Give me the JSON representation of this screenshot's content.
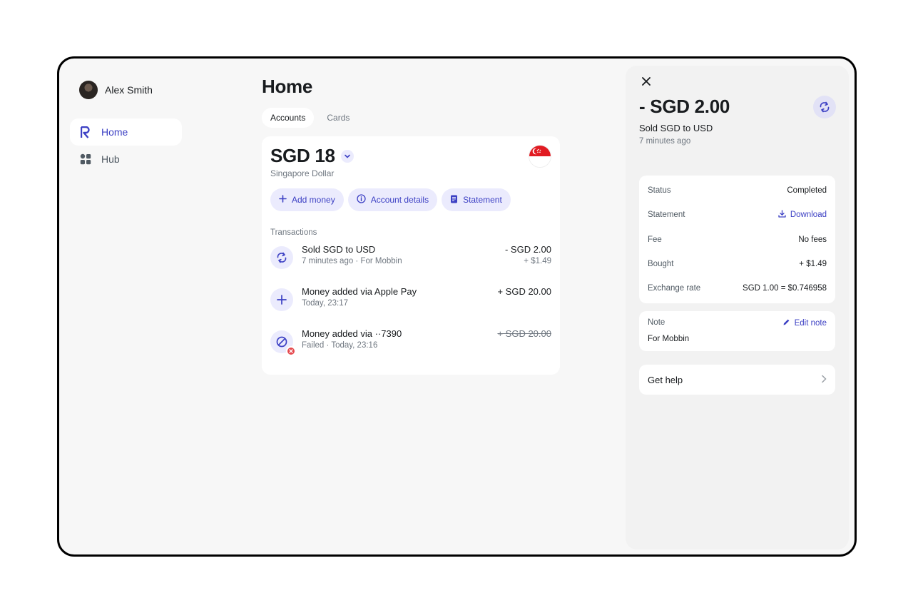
{
  "user": {
    "name": "Alex Smith"
  },
  "sidebar": {
    "items": [
      {
        "label": "Home",
        "icon": "revolut-logo-icon",
        "active": true
      },
      {
        "label": "Hub",
        "icon": "grid-icon",
        "active": false
      }
    ]
  },
  "main": {
    "title": "Home",
    "tabs": [
      {
        "label": "Accounts",
        "active": true
      },
      {
        "label": "Cards",
        "active": false
      }
    ],
    "account": {
      "balance": "SGD 18",
      "currency_name": "Singapore Dollar",
      "flag_icon": "singapore-flag-icon",
      "actions": [
        {
          "label": "Add money",
          "icon": "plus-icon"
        },
        {
          "label": "Account details",
          "icon": "info-icon"
        },
        {
          "label": "Statement",
          "icon": "document-icon"
        }
      ]
    },
    "transactions_header": "Transactions",
    "transactions": [
      {
        "title": "Sold SGD to USD",
        "subtitle": "7 minutes ago · For Mobbin",
        "amount": "- SGD 2.00",
        "secondary_amount": "+ $1.49",
        "icon": "exchange-icon",
        "failed": false
      },
      {
        "title": "Money added via Apple Pay",
        "subtitle": "Today, 23:17",
        "amount": "+ SGD 20.00",
        "secondary_amount": "",
        "icon": "plus-icon",
        "failed": false
      },
      {
        "title": "Money added via ··7390",
        "subtitle": "Failed · Today, 23:16",
        "amount": "+ SGD 20.00",
        "secondary_amount": "",
        "icon": "blocked-icon",
        "failed": true
      }
    ]
  },
  "detail": {
    "amount": "- SGD 2.00",
    "title": "Sold SGD to USD",
    "time": "7 minutes ago",
    "rows": [
      {
        "label": "Status",
        "value": "Completed",
        "link": false
      },
      {
        "label": "Statement",
        "value": "Download",
        "link": true
      },
      {
        "label": "Fee",
        "value": "No fees",
        "link": false
      },
      {
        "label": "Bought",
        "value": "+ $1.49",
        "link": false
      },
      {
        "label": "Exchange rate",
        "value": "SGD 1.00 = $0.746958",
        "link": false
      }
    ],
    "note": {
      "label": "Note",
      "edit_label": "Edit note",
      "text": "For Mobbin"
    },
    "help_label": "Get help"
  },
  "colors": {
    "accent": "#3d41c4",
    "accent_bg": "#ebebfd",
    "danger": "#e5484d",
    "flag_red": "#e11b22"
  }
}
